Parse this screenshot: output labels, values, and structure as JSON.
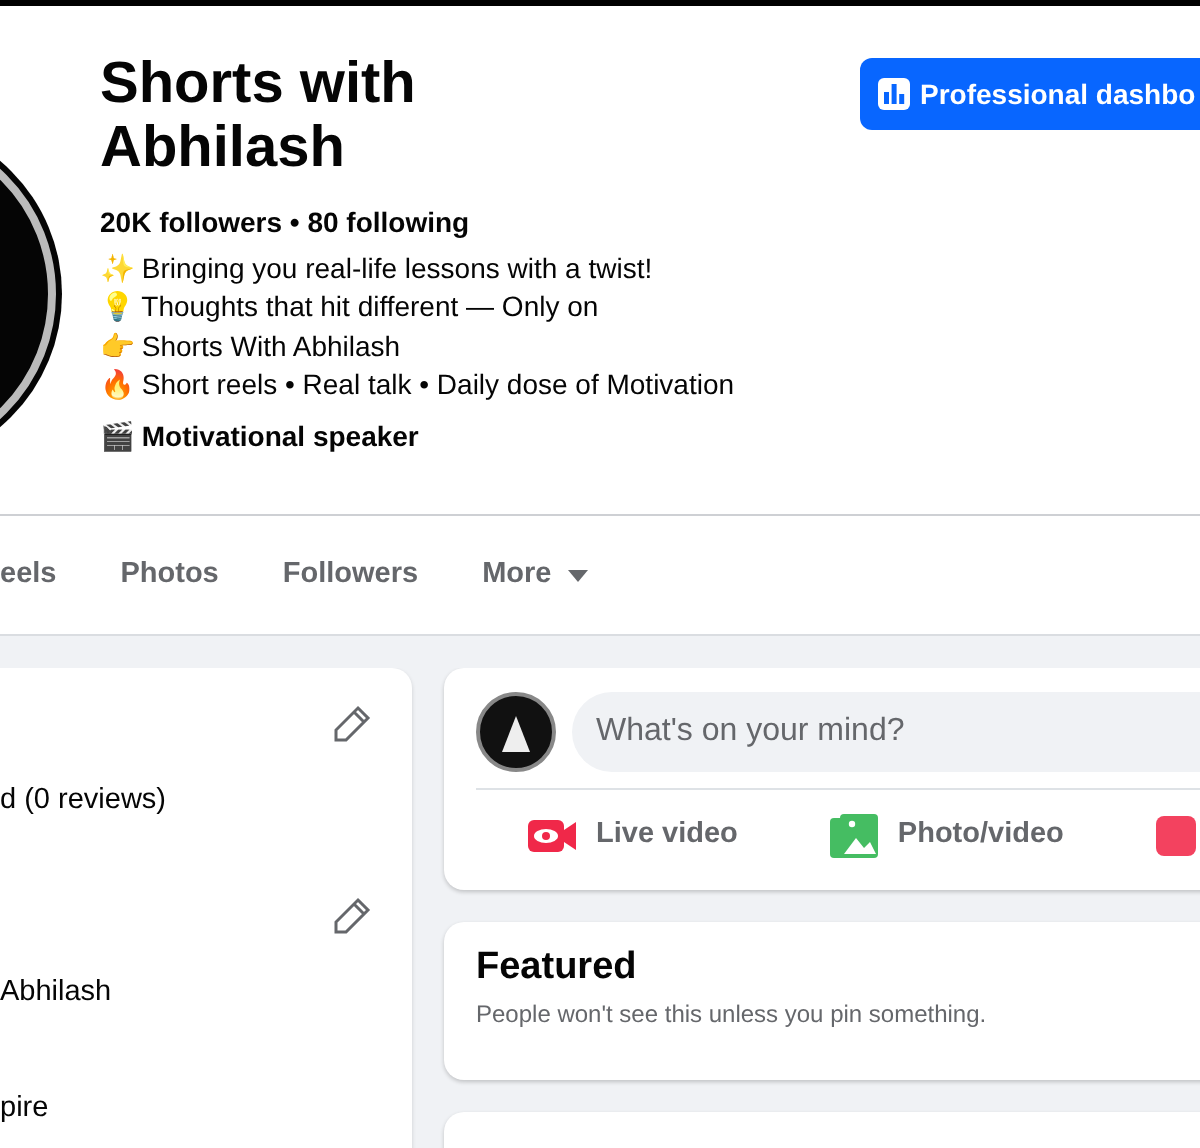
{
  "profile": {
    "name": "Shorts with Abhilash",
    "stats": "20K followers • 80 following",
    "bio": [
      "✨ Bringing you real-life lessons with a twist!",
      "💡 Thoughts that hit different — Only on",
      "👉 Shorts With Abhilash",
      "🔥 Short reels • Real talk • Daily dose of Motivation"
    ],
    "category": "🎬 Motivational speaker"
  },
  "dashboard_button": {
    "label": "Professional dashbo"
  },
  "tabs": [
    {
      "label": "eels",
      "selected": false,
      "kind": "plain"
    },
    {
      "label": "Photos",
      "selected": false,
      "kind": "plain"
    },
    {
      "label": "Followers",
      "selected": false,
      "kind": "plain"
    },
    {
      "label": "More",
      "selected": false,
      "kind": "dropdown"
    }
  ],
  "intro_card": {
    "items": [
      {
        "kind": "edit"
      },
      {
        "kind": "text",
        "text": "d (0 reviews)"
      },
      {
        "kind": "edit"
      },
      {
        "kind": "text",
        "text": "Abhilash"
      },
      {
        "kind": "text",
        "text": "pire"
      }
    ]
  },
  "composer": {
    "placeholder": "What's on your mind?",
    "actions": [
      {
        "kind": "live",
        "label": "Live video"
      },
      {
        "kind": "photo",
        "label": "Photo/video"
      },
      {
        "kind": "reel"
      }
    ]
  },
  "featured": {
    "title": "Featured",
    "subtitle": "People won't see this unless you pin something."
  }
}
